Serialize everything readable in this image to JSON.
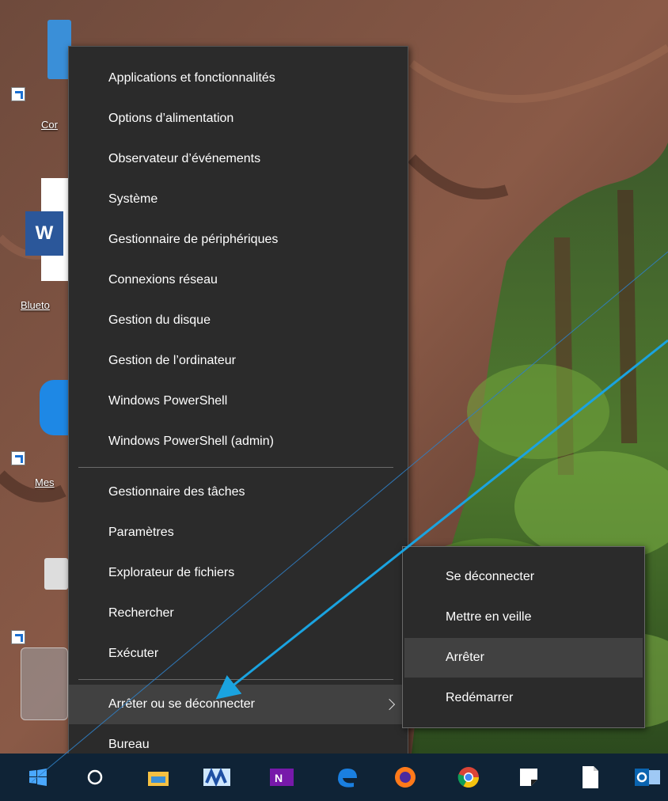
{
  "desktop": {
    "icons": [
      {
        "label": "Cor"
      },
      {
        "label": "Blueto"
      },
      {
        "label": "Mes"
      }
    ]
  },
  "menu": {
    "items": [
      {
        "label": "Applications et fonctionnalités"
      },
      {
        "label": "Options d’alimentation"
      },
      {
        "label": "Observateur d’événements"
      },
      {
        "label": "Système"
      },
      {
        "label": "Gestionnaire de périphériques"
      },
      {
        "label": "Connexions réseau"
      },
      {
        "label": "Gestion du disque"
      },
      {
        "label": "Gestion de l’ordinateur"
      },
      {
        "label": "Windows PowerShell"
      },
      {
        "label": "Windows PowerShell (admin)"
      },
      {
        "label": "Gestionnaire des tâches"
      },
      {
        "label": "Paramètres"
      },
      {
        "label": "Explorateur de fichiers"
      },
      {
        "label": "Rechercher"
      },
      {
        "label": "Exécuter"
      },
      {
        "label": "Arrêter ou se déconnecter"
      },
      {
        "label": "Bureau"
      }
    ],
    "hovered_item": "Arrêter ou se déconnecter"
  },
  "submenu": {
    "items": [
      {
        "label": "Se déconnecter"
      },
      {
        "label": "Mettre en veille"
      },
      {
        "label": "Arrêter"
      },
      {
        "label": "Redémarrer"
      }
    ],
    "hovered_item": "Arrêter"
  },
  "taskbar": {
    "apps": [
      "windows-start-icon",
      "cortana-icon",
      "file-explorer-icon",
      "mathway-icon",
      "onenote-icon",
      "edge-icon",
      "firefox-icon",
      "chrome-icon",
      "sticky-notes-icon",
      "notepad-icon",
      "outlook-icon"
    ]
  },
  "colors": {
    "menu_bg": "#2b2b2b",
    "menu_hover": "#414141",
    "taskbar_bg": "#0f2336",
    "annotation_arrow": "#1aa3e0"
  }
}
